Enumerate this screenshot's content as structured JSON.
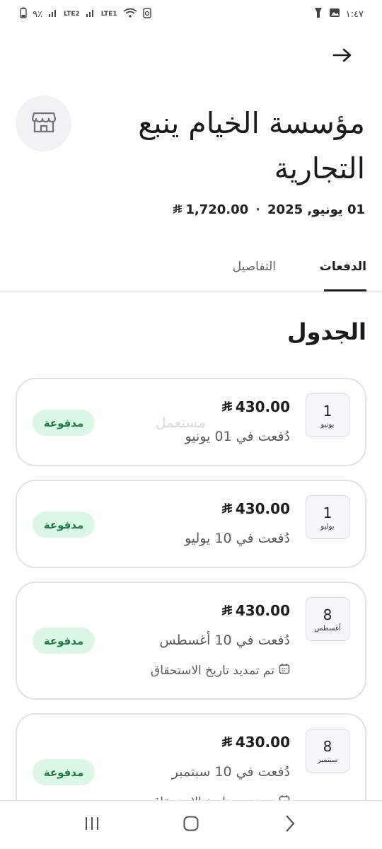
{
  "status_bar": {
    "battery": "٩٪",
    "signal_1": "LTE2",
    "signal_2": "LTE1",
    "time": "١:٤٧"
  },
  "header": {
    "title": "مؤسسة الخيام ينبع التجارية",
    "date": "01 يونيو, 2025",
    "separator": "·",
    "total": "1,720.00"
  },
  "tabs": [
    {
      "label": "الدفعات",
      "active": true
    },
    {
      "label": "التفاصيل",
      "active": false
    }
  ],
  "section_title": "الجدول",
  "watermark": "مستعمل",
  "payments": [
    {
      "day": "1",
      "month": "يونيو",
      "amount": "430.00",
      "paid_on": "دُفعت في 01 يونيو",
      "status": "مدفوعة"
    },
    {
      "day": "1",
      "month": "يوليو",
      "amount": "430.00",
      "paid_on": "دُفعت في 10 يوليو",
      "status": "مدفوعة"
    },
    {
      "day": "8",
      "month": "أغسطس",
      "amount": "430.00",
      "paid_on": "دُفعت في 10 أغسطس",
      "extended": "تم تمديد تاريخ الاستحقاق",
      "status": "مدفوعة"
    },
    {
      "day": "8",
      "month": "سبتمبر",
      "amount": "430.00",
      "paid_on": "دُفعت في 10 سبتمبر",
      "extended": "تم تمديد تاريخ الاستحقاق",
      "status": "مدفوعة"
    }
  ],
  "colors": {
    "paid_bg": "#ddf7e6",
    "paid_text": "#1e7a46",
    "card_border": "#e3e3e6"
  },
  "icons": {
    "back": "arrow-right-icon",
    "store": "store-icon",
    "currency": "riyal-icon",
    "calendar": "calendar-icon"
  }
}
